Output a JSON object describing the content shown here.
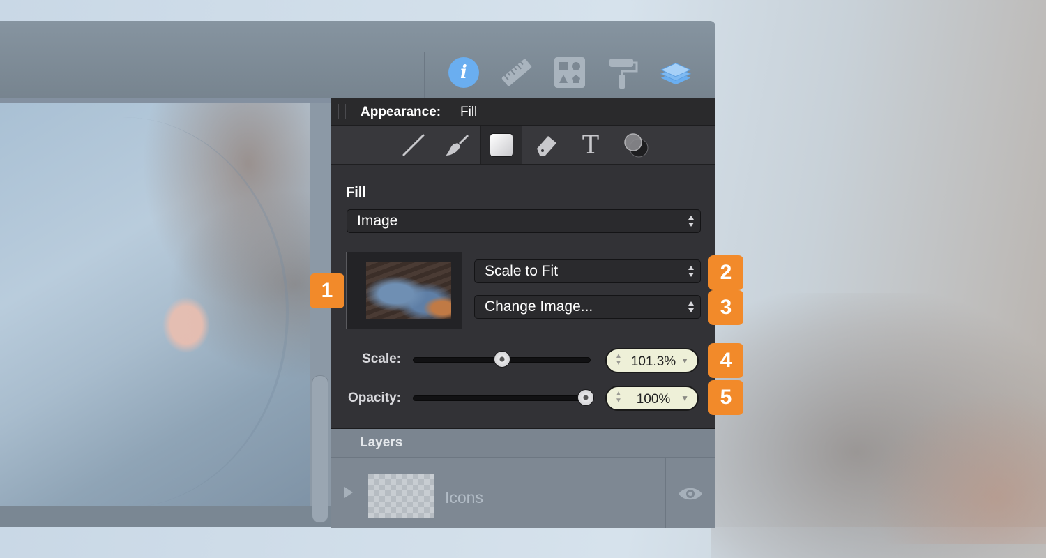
{
  "toolbar": {
    "icons": [
      "info-icon",
      "ruler-icon",
      "shapes-icon",
      "paint-roller-icon",
      "layers-icon"
    ],
    "info_glyph": "i",
    "accent": "#6aaef0"
  },
  "panel": {
    "title": "Appearance:",
    "subtitle": "Fill",
    "tools": [
      "line-icon",
      "brush-icon",
      "fill-icon",
      "eraser-icon",
      "text-icon",
      "shadow-icon"
    ],
    "active_tool": "fill-icon",
    "text_tool_glyph": "T",
    "fill_label": "Fill",
    "fill_type": "Image",
    "scale_mode": "Scale to Fit",
    "change_image": "Change Image...",
    "scale_label": "Scale:",
    "scale_value": "101.3%",
    "scale_level": 0.5,
    "opacity_label": "Opacity:",
    "opacity_value": "100%",
    "opacity_level": 1.0
  },
  "badges": [
    "1",
    "2",
    "3",
    "4",
    "5"
  ],
  "badge_color": "#f28a2a",
  "layers": {
    "title": "Layers",
    "items": [
      {
        "name": "Icons"
      }
    ]
  }
}
